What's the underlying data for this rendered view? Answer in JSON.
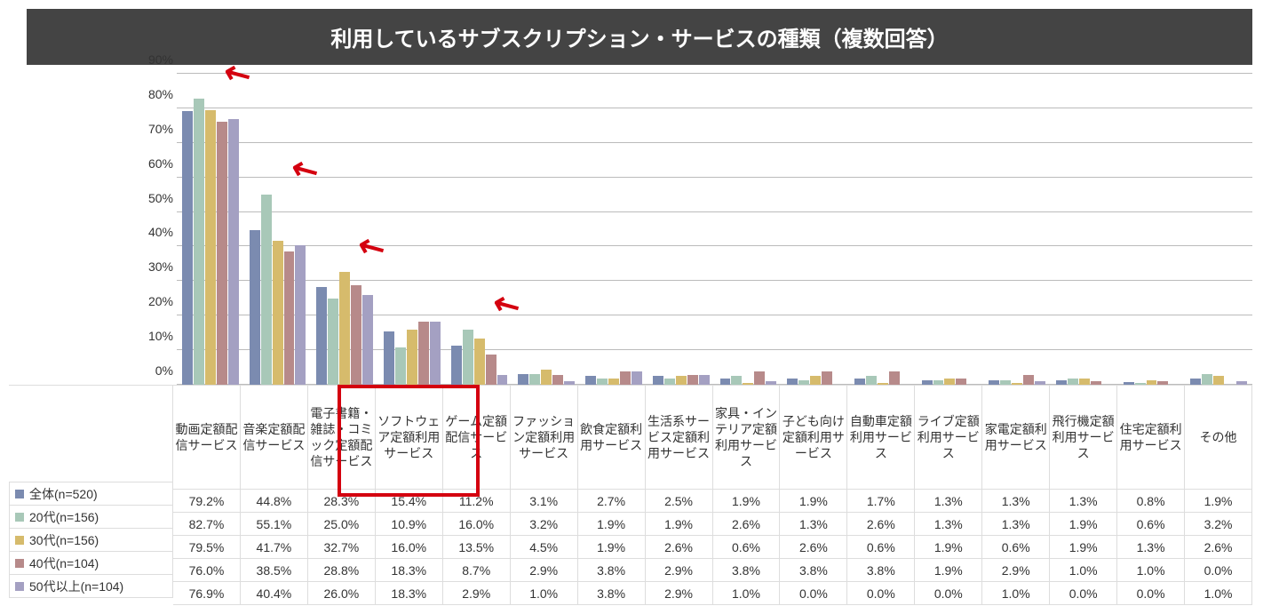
{
  "title": "利用しているサブスクリプション・サービスの種類（複数回答）",
  "chart_data": {
    "type": "bar",
    "ylabel": "",
    "ylim": [
      0,
      90
    ],
    "yticks": [
      "0%",
      "10%",
      "20%",
      "30%",
      "40%",
      "50%",
      "60%",
      "70%",
      "80%",
      "90%"
    ],
    "categories": [
      "動画定額配信サービス",
      "音楽定額配信サービス",
      "電子書籍・雑誌・コミック定額配信サービス",
      "ソフトウェア定額利用サービス",
      "ゲーム定額配信サービス",
      "ファッション定額利用サービス",
      "飲食定額利用サービス",
      "生活系サービス定額利用サービス",
      "家具・インテリア定額利用サービス",
      "子ども向け定額利用サービス",
      "自動車定額利用サービス",
      "ライブ定額利用サービス",
      "家電定額利用サービス",
      "飛行機定額利用サービス",
      "住宅定額利用サービス",
      "その他"
    ],
    "series": [
      {
        "name": "全体(n=520)",
        "color": "#7b8bb0",
        "values": [
          79.2,
          44.8,
          28.3,
          15.4,
          11.2,
          3.1,
          2.7,
          2.5,
          1.9,
          1.9,
          1.7,
          1.3,
          1.3,
          1.3,
          0.8,
          1.9
        ]
      },
      {
        "name": "20代(n=156)",
        "color": "#a8c8b8",
        "values": [
          82.7,
          55.1,
          25.0,
          10.9,
          16.0,
          3.2,
          1.9,
          1.9,
          2.6,
          1.3,
          2.6,
          1.3,
          1.3,
          1.9,
          0.6,
          3.2
        ]
      },
      {
        "name": "30代(n=156)",
        "color": "#d6bb6c",
        "values": [
          79.5,
          41.7,
          32.7,
          16.0,
          13.5,
          4.5,
          1.9,
          2.6,
          0.6,
          2.6,
          0.6,
          1.9,
          0.6,
          1.9,
          1.3,
          2.6
        ]
      },
      {
        "name": "40代(n=104)",
        "color": "#b78a8a",
        "values": [
          76.0,
          38.5,
          28.8,
          18.3,
          8.7,
          2.9,
          3.8,
          2.9,
          3.8,
          3.8,
          3.8,
          1.9,
          2.9,
          1.0,
          1.0,
          0.0
        ]
      },
      {
        "name": "50代以上(n=104)",
        "color": "#a4a0c2",
        "values": [
          76.9,
          40.4,
          26.0,
          18.3,
          2.9,
          1.0,
          3.8,
          2.9,
          1.0,
          0.0,
          0.0,
          0.0,
          1.0,
          0.0,
          0.0,
          1.0
        ]
      }
    ],
    "arrows_on": [
      0,
      1,
      2,
      4
    ],
    "highlight_categories": [
      0,
      1
    ]
  }
}
